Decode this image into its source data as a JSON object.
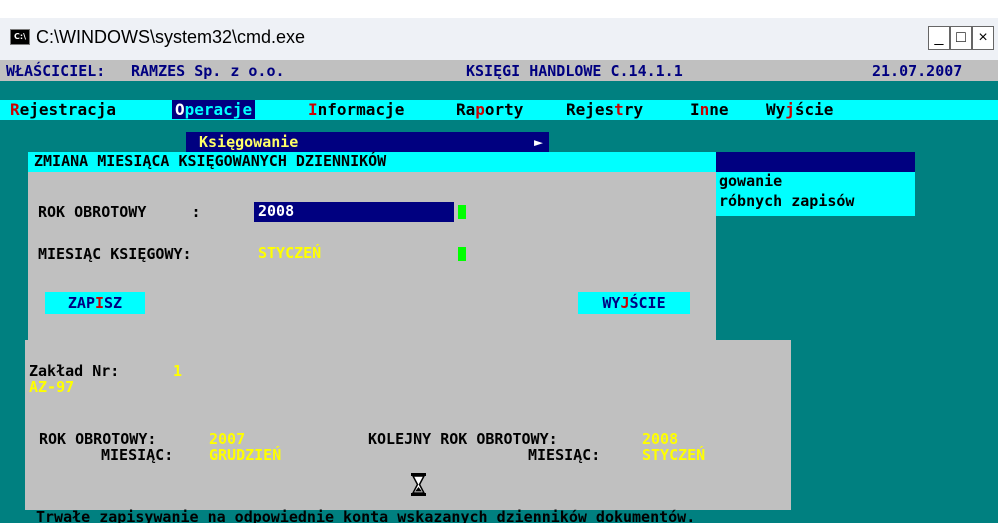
{
  "window": {
    "title": "C:\\WINDOWS\\system32\\cmd.exe",
    "icon": "cmd-icon",
    "controls": {
      "minimize": "_",
      "maximize": "□",
      "close": "×"
    }
  },
  "header": {
    "owner_label": "WŁAŚCICIEL:",
    "owner_value": "RAMZES Sp. z o.o.",
    "app_name": "KSIĘGI HANDLOWE C.14.1.1",
    "date": "21.07.2007"
  },
  "menu": {
    "items": [
      {
        "hot": "R",
        "rest": "ejestracja"
      },
      {
        "hot": "O",
        "rest": "peracje"
      },
      {
        "hot": "I",
        "rest": "nformacje"
      },
      {
        "pre": "Ra",
        "hot": "p",
        "rest": "orty"
      },
      {
        "pre": "Rejes",
        "hot": "t",
        "rest": "ry"
      },
      {
        "pre": "I",
        "hot": "n",
        "rest": "ne"
      },
      {
        "pre": "Wy",
        "hot": "j",
        "rest": "ście"
      }
    ],
    "active_index": 1
  },
  "submenu": {
    "label": "Księgowanie",
    "arrow": "►",
    "partial_line_1": "gowanie",
    "partial_line_2": "róbnych zapisów"
  },
  "dialog": {
    "title": "ZMIANA MIESIĄCA KSIĘGOWANYCH DZIENNIKÓW",
    "rok_label": "ROK OBROTOWY     :",
    "rok_value": "2008",
    "miesiac_label": "MIESIĄC KSIĘGOWY:",
    "miesiac_value": "STYCZEŃ",
    "save_pre": "ZAP",
    "save_hot": "I",
    "save_post": "SZ",
    "exit_pre": "WY",
    "exit_hot": "J",
    "exit_post": "ŚCIE"
  },
  "info": {
    "zaklad_label": "Zakład Nr:",
    "zaklad_value": "1",
    "zaklad_name": "AZ-97",
    "rok_label": "ROK OBROTOWY:",
    "rok_value": "2007",
    "miesiac_label": "MIESIĄC:",
    "miesiac_value": "GRUDZIEŃ",
    "next_rok_label": "KOLEJNY ROK OBROTOWY:",
    "next_rok_value": "2008",
    "next_miesiac_label": "MIESIĄC:",
    "next_miesiac_value": "STYCZEŃ"
  },
  "status": {
    "text": "Trwałe zapisywanie na odpowiednie konta wskazanych dzienników dokumentów."
  },
  "colors": {
    "console_bg": "#008080",
    "menu_bg": "#00ffff",
    "highlight": "#000080",
    "value_yellow": "#ffff00",
    "hotkey_red": "#cc0000",
    "cursor_green": "#00ff00"
  },
  "cursor_icon": "hourglass-icon"
}
